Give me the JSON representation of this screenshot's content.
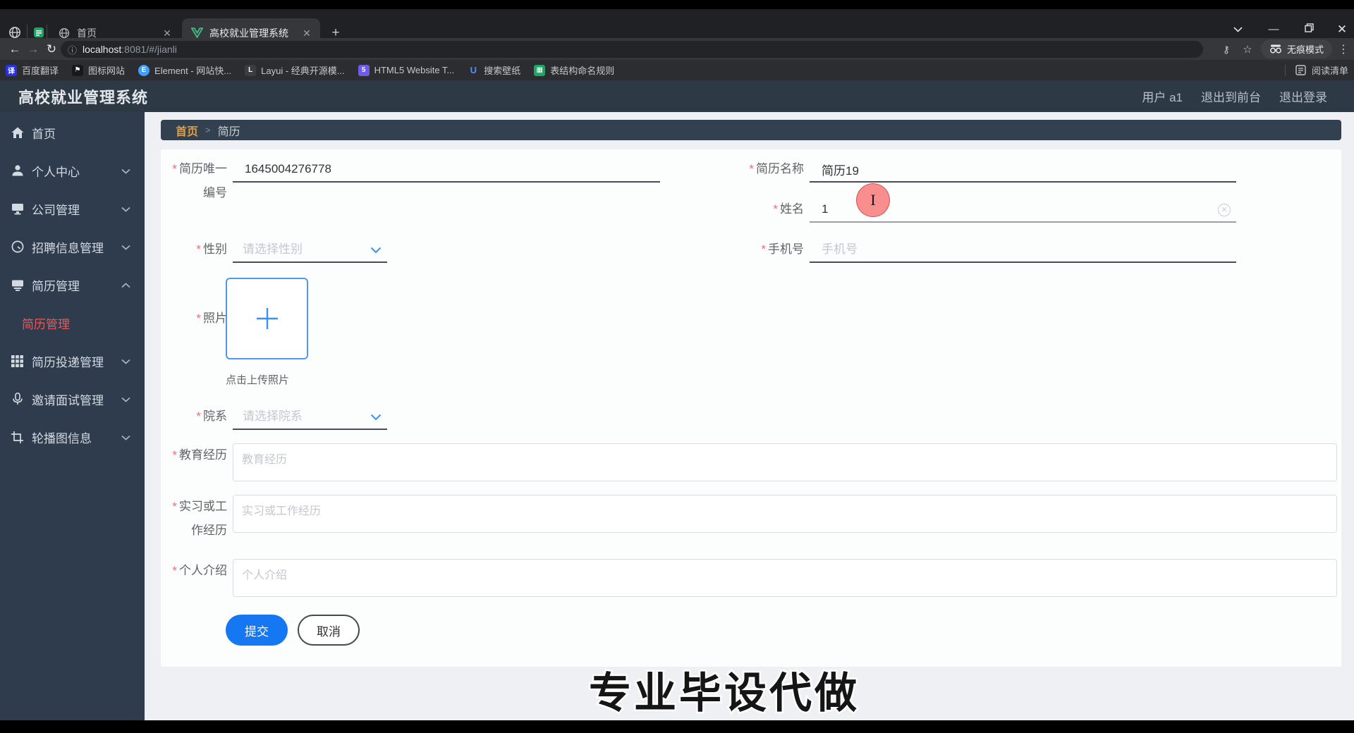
{
  "browser": {
    "tabs": [
      {
        "title": "首页"
      },
      {
        "title": "高校就业管理系统"
      }
    ],
    "new_tab_glyph": "+",
    "close_glyph": "✕",
    "url": {
      "info_glyph": "ⓘ",
      "host": "localhost",
      "rest": ":8081/#/jianli"
    },
    "back_glyph": "←",
    "forward_glyph": "→",
    "reload_glyph": "↻",
    "key_glyph": "⚷",
    "star_glyph": "☆",
    "menu_glyph": "⋮",
    "min_glyph": "—",
    "incognito_label": "无痕模式",
    "bookmarks": [
      {
        "label": "百度翻译",
        "glyph": "译",
        "color": "#2932e1"
      },
      {
        "label": "图标网站",
        "glyph": "⚑",
        "color": "#17181c"
      },
      {
        "label": "Element - 网站快...",
        "glyph": "E",
        "color": "#409eff"
      },
      {
        "label": "Layui - 经典开源模...",
        "glyph": "L",
        "color": "#3a3d42"
      },
      {
        "label": "HTML5 Website T...",
        "glyph": "5",
        "color": "#6c5ce7"
      },
      {
        "label": "搜索壁纸",
        "glyph": "U",
        "color": "#5b8cff"
      },
      {
        "label": "表结构命名规则",
        "glyph": "▦",
        "color": "#21a366"
      }
    ],
    "reading_list": "阅读清单"
  },
  "app": {
    "title": "高校就业管理系统",
    "header_links": {
      "user": "用户 a1",
      "to_front": "退出到前台",
      "logout": "退出登录"
    },
    "sidebar": {
      "items": [
        {
          "label": "首页"
        },
        {
          "label": "个人中心"
        },
        {
          "label": "公司管理"
        },
        {
          "label": "招聘信息管理"
        },
        {
          "label": "简历管理"
        },
        {
          "label": "简历投递管理"
        },
        {
          "label": "邀请面试管理"
        },
        {
          "label": "轮播图信息"
        }
      ],
      "active_sub": "简历管理"
    },
    "breadcrumb": {
      "home": "首页",
      "sep": ">",
      "current": "简历"
    },
    "form": {
      "resume_no": {
        "label": "简历唯一编号",
        "value": "1645004276778"
      },
      "resume_name": {
        "label": "简历名称",
        "value": "简历19"
      },
      "name": {
        "label": "姓名",
        "value": "1"
      },
      "gender": {
        "label": "性别",
        "placeholder": "请选择性别"
      },
      "phone": {
        "label": "手机号",
        "placeholder": "手机号"
      },
      "photo": {
        "label": "照片",
        "hint": "点击上传照片"
      },
      "dept": {
        "label": "院系",
        "placeholder": "请选择院系"
      },
      "edu": {
        "label": "教育经历",
        "placeholder": "教育经历"
      },
      "work": {
        "label": "实习或工作经历",
        "placeholder": "实习或工作经历"
      },
      "intro": {
        "label": "个人介绍",
        "placeholder": "个人介绍"
      },
      "submit": "提交",
      "cancel": "取消",
      "required_mark": "*"
    },
    "watermark": "专业毕设代做",
    "colors": {
      "primary": "#1577f2",
      "danger": "#f56c6c",
      "sidebar_active": "#f25454",
      "breadcrumb_home": "#dfa044"
    }
  }
}
